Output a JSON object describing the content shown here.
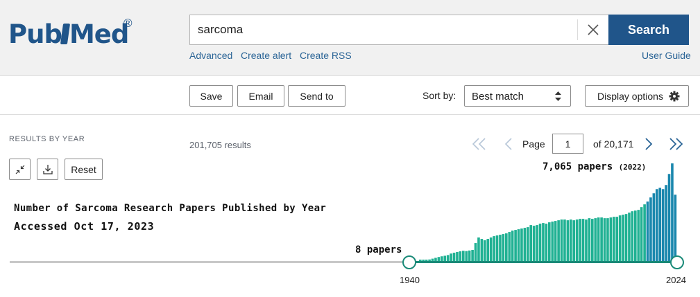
{
  "header": {
    "logo": {
      "word_left": "Pub",
      "word_right": "Med",
      "reg": "®"
    },
    "search": {
      "value": "sarcoma",
      "placeholder": ""
    },
    "search_button": "Search",
    "links": {
      "advanced": "Advanced",
      "create_alert": "Create alert",
      "create_rss": "Create RSS",
      "user_guide": "User Guide"
    }
  },
  "actions": {
    "save": "Save",
    "email": "Email",
    "send_to": "Send to",
    "sort_label": "Sort by:",
    "sort_value": "Best match",
    "display_options": "Display options"
  },
  "timeline": {
    "section_label": "RESULTS BY YEAR",
    "reset": "Reset",
    "start_year": "1940",
    "end_year": "2024"
  },
  "results": {
    "count_text": "201,705 results",
    "page_label": "Page",
    "page_value": "1",
    "page_of": "of 20,171"
  },
  "annotations": {
    "title": "Number of Sarcoma Research Papers Published by Year",
    "accessed": "Accessed Oct 17, 2023",
    "min_label": "8 papers",
    "max_label": "7,065 papers",
    "max_year": "(2022)"
  },
  "colors": {
    "brand": "#20558a",
    "link": "#2a6496",
    "bar": "#20b193",
    "bar_recent": "#1a87ad",
    "handle": "#1a8a78"
  },
  "chart_data": {
    "type": "bar",
    "xlabel": "",
    "ylabel": "",
    "x": [
      1940,
      1941,
      1942,
      1943,
      1944,
      1945,
      1946,
      1947,
      1948,
      1949,
      1950,
      1951,
      1952,
      1953,
      1954,
      1955,
      1956,
      1957,
      1958,
      1959,
      1960,
      1961,
      1962,
      1963,
      1964,
      1965,
      1966,
      1967,
      1968,
      1969,
      1970,
      1971,
      1972,
      1973,
      1974,
      1975,
      1976,
      1977,
      1978,
      1979,
      1980,
      1981,
      1982,
      1983,
      1984,
      1985,
      1986,
      1987,
      1988,
      1989,
      1990,
      1991,
      1992,
      1993,
      1994,
      1995,
      1996,
      1997,
      1998,
      1999,
      2000,
      2001,
      2002,
      2003,
      2004,
      2005,
      2006,
      2007,
      2008,
      2009,
      2010,
      2011,
      2012,
      2013,
      2014,
      2015,
      2016,
      2017,
      2018,
      2019,
      2020,
      2021,
      2022,
      2023
    ],
    "values": [
      8,
      15,
      40,
      110,
      170,
      230,
      290,
      340,
      380,
      430,
      540,
      600,
      650,
      700,
      740,
      720,
      760,
      800,
      1300,
      1700,
      1600,
      1500,
      1600,
      1700,
      1800,
      1850,
      1900,
      1950,
      2000,
      2100,
      2200,
      2250,
      2300,
      2350,
      2400,
      2450,
      2600,
      2550,
      2600,
      2700,
      2750,
      2700,
      2800,
      2850,
      2900,
      2950,
      3000,
      3000,
      2950,
      3000,
      2950,
      3000,
      3050,
      3050,
      3000,
      3100,
      3050,
      3100,
      3150,
      3150,
      3100,
      3100,
      3150,
      3200,
      3200,
      3300,
      3350,
      3400,
      3500,
      3600,
      3650,
      3700,
      3900,
      4100,
      4300,
      4600,
      4900,
      5200,
      5300,
      5200,
      5500,
      6300,
      7065,
      4800
    ],
    "xlim": [
      1940,
      2024
    ],
    "ylim": [
      0,
      7065
    ]
  }
}
